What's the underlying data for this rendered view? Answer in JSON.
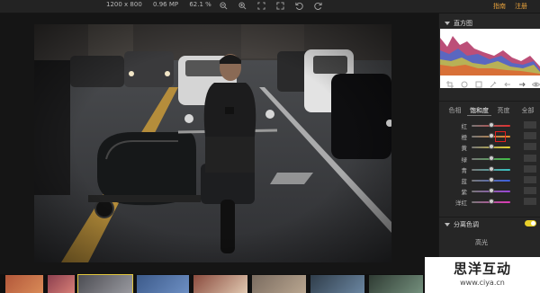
{
  "topbar": {
    "dimensions": "1200 x 800",
    "megapixels": "0.96 MP",
    "zoom": "62.1 %",
    "links": {
      "guide": "指南",
      "register": "注册"
    }
  },
  "panel": {
    "histogram_title": "直方图",
    "tabs": [
      "色相",
      "饱和度",
      "亮度",
      "全部"
    ],
    "active_tab": "饱和度",
    "hsl_sliders": [
      {
        "label": "红",
        "color": "#e03030",
        "value": 0.5
      },
      {
        "label": "橙",
        "color": "#e88a2a",
        "value": 0.5
      },
      {
        "label": "黄",
        "color": "#e6d430",
        "value": 0.5
      },
      {
        "label": "绿",
        "color": "#3fbf45",
        "value": 0.5
      },
      {
        "label": "青",
        "color": "#37c4c4",
        "value": 0.5
      },
      {
        "label": "蓝",
        "color": "#3b5fe0",
        "value": 0.5
      },
      {
        "label": "紫",
        "color": "#9a45d8",
        "value": 0.5
      },
      {
        "label": "洋红",
        "color": "#e038b8",
        "value": 0.5
      }
    ],
    "split_toning_title": "分离色调",
    "highlights_label": "高光"
  },
  "watermark": {
    "title": "思洋互动",
    "url": "www.ciya.cn"
  },
  "colors": {
    "accent": "#e8a23c",
    "toggle": "#e8cf2a",
    "selected_thumb": "#e1c53c"
  }
}
